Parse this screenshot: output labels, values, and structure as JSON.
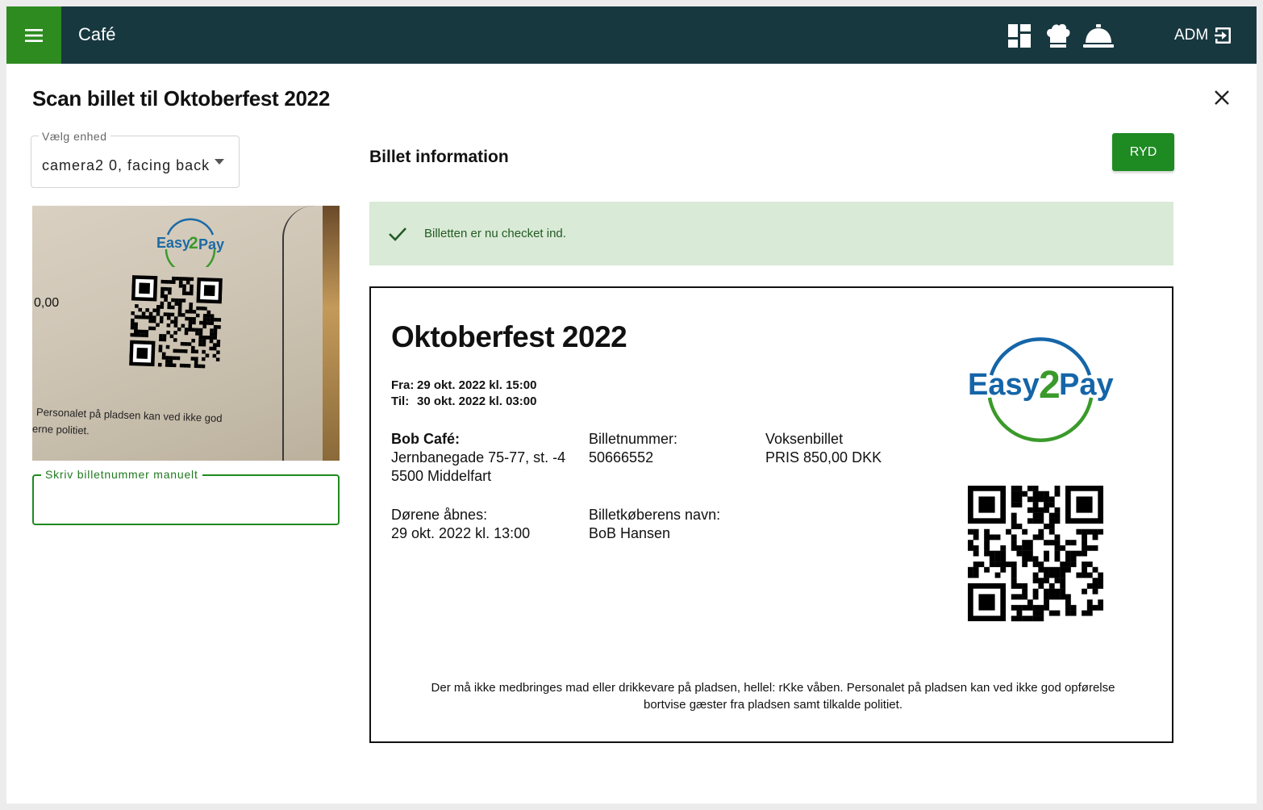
{
  "header": {
    "app_title": "Café",
    "user_label": "ADM",
    "icons": [
      "menu-icon",
      "dashboard-icon",
      "chef-hat-icon",
      "service-bell-icon",
      "logout-icon"
    ]
  },
  "dialog": {
    "title": "Scan billet til Oktoberfest 2022"
  },
  "device_select": {
    "label": "Vælg enhed",
    "value": "camera2 0, facing back"
  },
  "camera_preview": {
    "logo_text_easy": "Easy",
    "logo_text_2": "2",
    "logo_text_pay": "Pay",
    "price_fragment": "0,00",
    "text_line1": "Personalet på pladsen kan ved ikke god",
    "text_line2": "erne politiet."
  },
  "manual_entry": {
    "label": "Skriv billetnummer manuelt",
    "value": ""
  },
  "info": {
    "title": "Billet information",
    "clear_button": "RYD"
  },
  "alert": {
    "message": "Billetten er nu checket ind."
  },
  "ticket": {
    "event_name": "Oktoberfest 2022",
    "from_label": "Fra:",
    "from_value": "29 okt. 2022 kl. 15:00",
    "to_label": "Til:",
    "to_value": "30 okt. 2022 kl. 03:00",
    "venue_name": "Bob Café:",
    "venue_address1": "Jernbanegade 75-77, st. -4",
    "venue_address2": "5500 Middelfart",
    "ticket_number_label": "Billetnummer:",
    "ticket_number": "50666552",
    "ticket_type": "Voksenbillet",
    "price": "PRIS 850,00 DKK",
    "doors_label": "Dørene åbnes:",
    "doors_value": "29 okt. 2022 kl. 13:00",
    "buyer_label": "Billetkøberens navn:",
    "buyer_name": "BoB Hansen",
    "logo_easy": "Easy",
    "logo_2": "2",
    "logo_pay": "Pay",
    "footer_line1": "Der må ikke medbringes mad eller drikkevare på pladsen, hellel: rKke våben. Personalet på pladsen kan ved ikke god opførelse",
    "footer_line2": "bortvise gæster fra pladsen samt tilkalde politiet."
  },
  "colors": {
    "topbar": "#183840",
    "accent_green": "#2e8b1f",
    "button_green": "#1e8a22",
    "alert_bg": "#d9ead6",
    "logo_blue": "#1565a8",
    "logo_green": "#3a9a2a"
  }
}
